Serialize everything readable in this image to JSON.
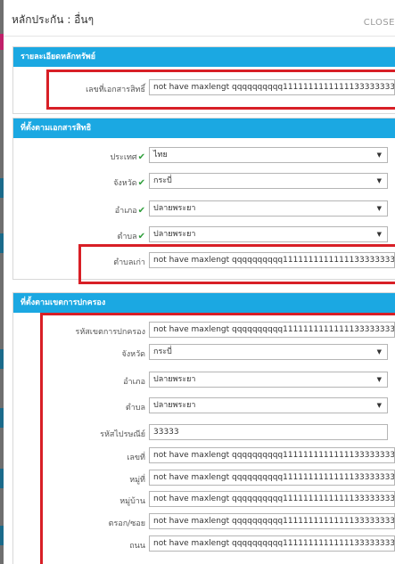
{
  "modal": {
    "title": "หลักประกัน : อื่นๆ",
    "close_label": "CLOSE"
  },
  "section_detail": {
    "header": "รายละเอียดหลักทรัพย์",
    "doc_number_label": "เลขที่เอกสารสิทธิ์",
    "doc_number_value": "not have maxlengt qqqqqqqqqq11111111111111333333333"
  },
  "section_doc_address": {
    "header": "ที่ตั้งตามเอกสารสิทธิ",
    "country_label": "ประเทศ",
    "country_value": "ไทย",
    "province_label": "จังหวัด",
    "province_value": "กระบี่",
    "district_label": "อำเภอ",
    "district_value": "ปลายพระยา",
    "subdistrict_label": "ตำบล",
    "subdistrict_value": "ปลายพระยา",
    "old_subdistrict_label": "ตำบลเก่า",
    "old_subdistrict_value": "not have maxlengt qqqqqqqqqq11111111111111333333333",
    "check_mark": "✔"
  },
  "section_admin_address": {
    "header": "ที่ตั้งตามเขตการปกครอง",
    "admin_code_label": "รหัสเขตการปกครอง",
    "admin_code_value": "not have maxlengt qqqqqqqqqq11111111111111333333333",
    "province_label": "จังหวัด",
    "province_value": "กระบี่",
    "district_label": "อำเภอ",
    "district_value": "ปลายพระยา",
    "subdistrict_label": "ตำบล",
    "subdistrict_value": "ปลายพระยา",
    "postal_label": "รหัสไปรษณีย์",
    "postal_value": "33333",
    "house_no_label": "เลขที่",
    "house_no_value": "not have maxlengt qqqqqqqqqq11111111111111333333333",
    "moo_label": "หมู่ที่",
    "moo_value": "not have maxlengt qqqqqqqqqq11111111111111333333333",
    "village_label": "หมู่บ้าน",
    "village_value": "not have maxlengt qqqqqqqqqq11111111111111333333333",
    "soi_label": "ตรอก/ซอย",
    "soi_value": "not have maxlengt qqqqqqqqqq11111111111111333333333",
    "road_label": "ถนน",
    "road_value": "not have maxlengt qqqqqqqqqq11111111111111333333333"
  },
  "icons": {
    "dropdown": "caret-down-icon",
    "valid": "check-icon"
  },
  "colors": {
    "section_header": "#1ba8e2",
    "highlight": "#d81f26",
    "check": "#2e9e3a"
  }
}
